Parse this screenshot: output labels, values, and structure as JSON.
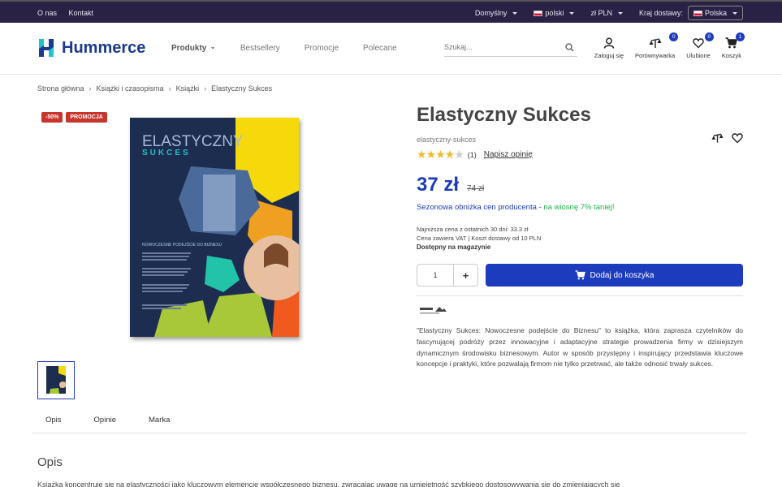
{
  "topbar": {
    "links": [
      "O nas",
      "Kontakt"
    ],
    "theme": "Domyślny",
    "language": "polski",
    "currency": "zł PLN",
    "country_label": "Kraj dostawy:",
    "country": "Polska"
  },
  "header": {
    "logo": "Hummerce",
    "nav": [
      "Produkty",
      "Bestsellery",
      "Promocje",
      "Polecane"
    ],
    "search_placeholder": "Szukaj...",
    "icons": [
      {
        "label": "Zaloguj się"
      },
      {
        "label": "Porównywarka",
        "badge": "0"
      },
      {
        "label": "Ulubione",
        "badge": "0"
      },
      {
        "label": "Koszyk",
        "badge": "1"
      }
    ]
  },
  "breadcrumb": [
    "Strona główna",
    "Książki i czasopisma",
    "Książki",
    "Elastyczny Sukces"
  ],
  "gallery": {
    "labels": [
      "-50%",
      "PROMOCJA"
    ],
    "cover_title": "ELASTYCZNY",
    "cover_subtitle": "SUKCES",
    "cover_tagline": "NOWOCZESNE PODEJŚCIE DO BIZNESU"
  },
  "product": {
    "title": "Elastyczny Sukces",
    "slug": "elastyczny-sukces",
    "rating": 4,
    "rating_max": 5,
    "review_count": "(1)",
    "review_link": "Napisz opinię",
    "price": "37 zł",
    "old_price": "74 zł",
    "promo_text": "Sezonowa obniżka cen producenta - ",
    "promo_highlight": "na wiosnę 7% taniej!",
    "lowest_price": "Najniższa cena z ostatnich 30 dni: 33.3 zł",
    "vat": "Cena zawiera VAT | Koszt dostawy od 10 PLN",
    "availability": "Dostępny na magazynie",
    "quantity": "1",
    "plus": "+",
    "add_to_cart": "Dodaj do koszyka",
    "description": "\"Elastyczny Sukces: Nowoczesne podejście do Biznesu\" to książka, która zaprasza czytelników do fascynującej podróży przez innowacyjne i adaptacyjne strategie prowadzenia firmy w dzisiejszym dynamicznym środowisku biznesowym. Autor w sposób przystępny i inspirujący przedstawia kluczowe koncepcje i praktyki, które pozwalają firmom nie tylko przetrwać, ale także odnosić trwały sukces."
  },
  "tabs": [
    "Opis",
    "Opinie",
    "Marka"
  ],
  "section": {
    "title": "Opis",
    "text": "Książka koncentruje się na elastyczności jako kluczowym elemencie współczesnego biznesu, zwracając uwagę na umiejętność szybkiego dostosowywania się do zmieniających się"
  },
  "colors": {
    "primary": "#1d3bbd",
    "topbar": "#2a2245",
    "badge_red": "#c8352c",
    "promo_green": "#22b14c",
    "star": "#f5b82e"
  }
}
